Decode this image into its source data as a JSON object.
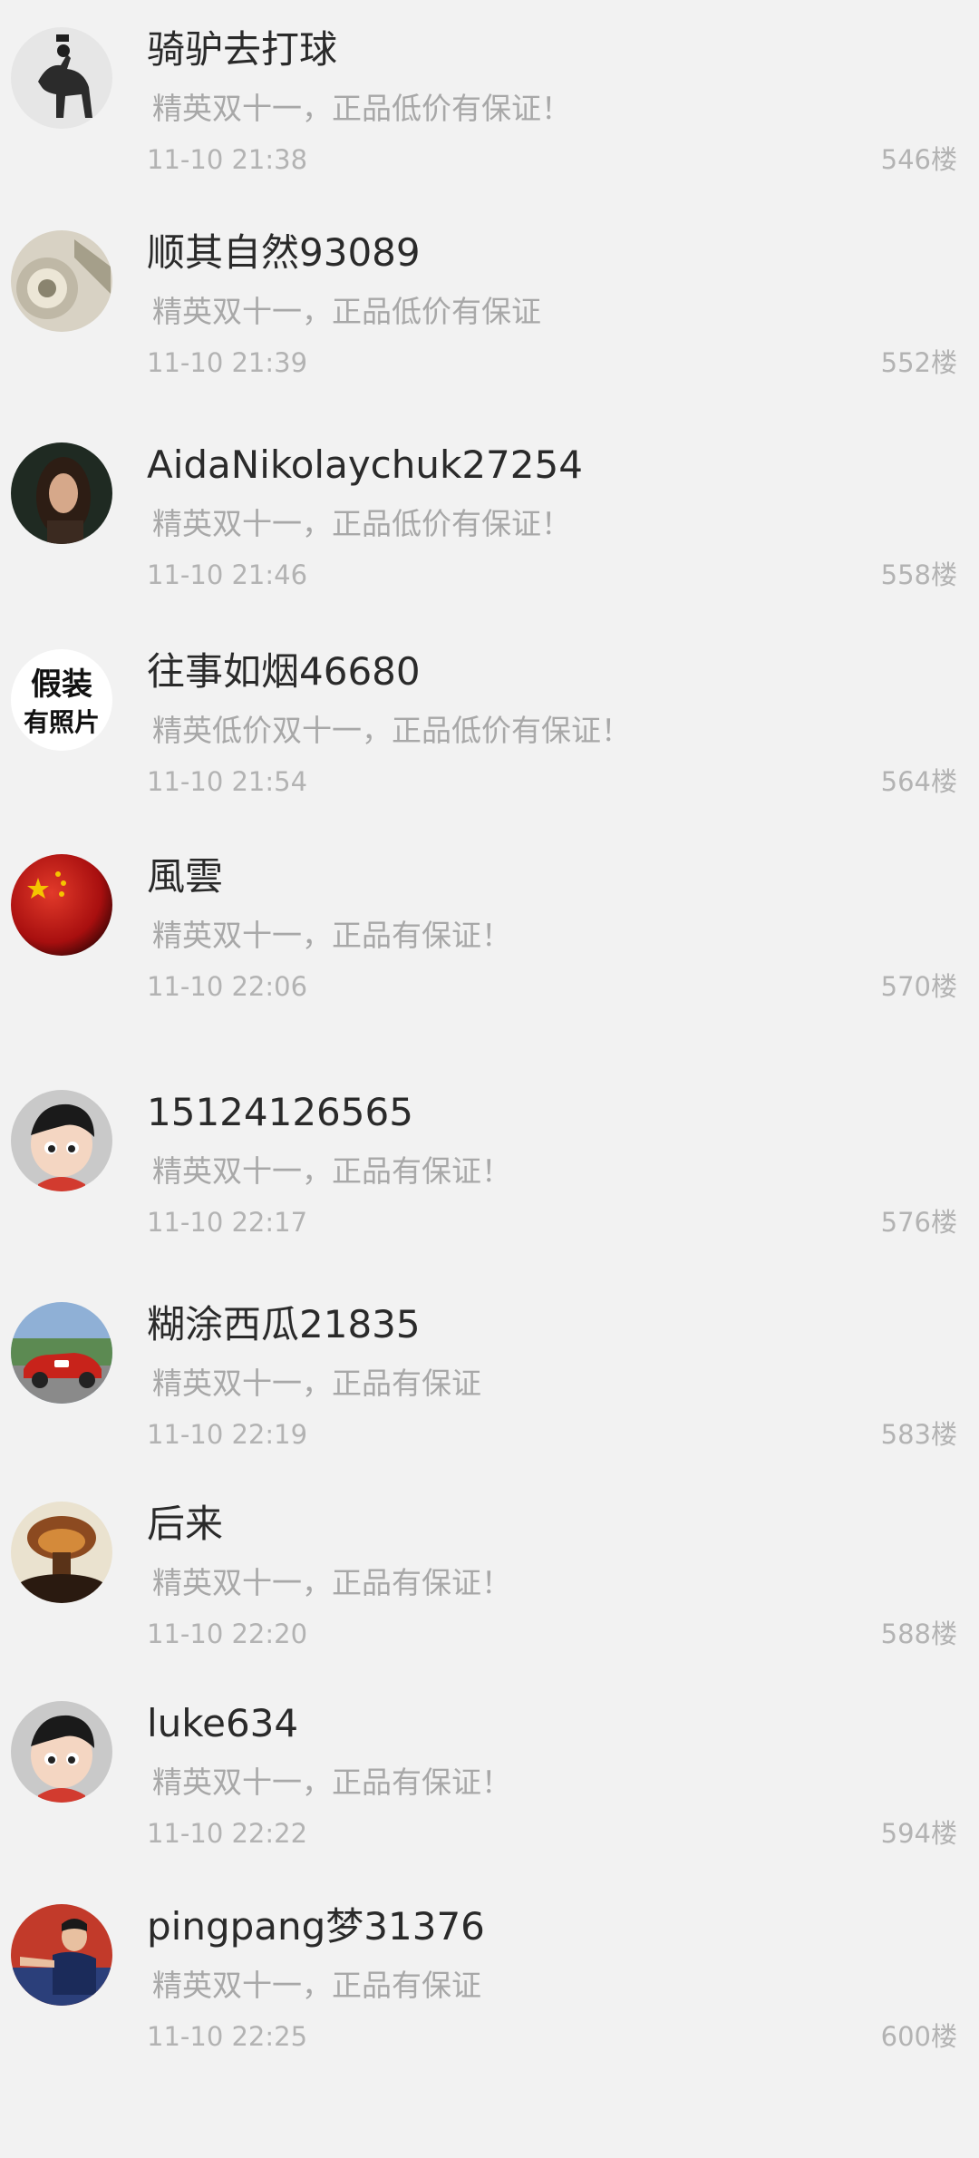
{
  "comments": [
    {
      "name": "骑驴去打球",
      "content": "精英双十一，正品低价有保证！",
      "time": "11-10 21:38",
      "floor": "546楼",
      "avatar_icon": "donkey-rider-avatar-icon"
    },
    {
      "name": "顺其自然93089",
      "content": "精英双十一，正品低价有保证",
      "time": "11-10 21:39",
      "floor": "552楼",
      "avatar_icon": "watch-avatar-icon"
    },
    {
      "name": "AidaNikolaychuk27254",
      "content": "精英双十一，正品低价有保证！",
      "time": "11-10 21:46",
      "floor": "558楼",
      "avatar_icon": "girl-portrait-avatar-icon"
    },
    {
      "name": "往事如烟46680",
      "content": "精英低价双十一，正品低价有保证！",
      "time": "11-10 21:54",
      "floor": "564楼",
      "avatar_icon": "text-stamp-avatar-icon",
      "avatar_text": "假装有照片"
    },
    {
      "name": "風雲",
      "content": "精英双十一，正品有保证！",
      "time": "11-10 22:06",
      "floor": "570楼",
      "avatar_icon": "red-flag-sphere-avatar-icon"
    },
    {
      "name": "15124126565",
      "content": "精英双十一，正品有保证！",
      "time": "11-10 22:17",
      "floor": "576楼",
      "avatar_icon": "cartoon-boy-avatar-icon"
    },
    {
      "name": "糊涂西瓜21835",
      "content": "精英双十一，正品有保证",
      "time": "11-10 22:19",
      "floor": "583楼",
      "avatar_icon": "red-car-avatar-icon"
    },
    {
      "name": "后来",
      "content": "精英双十一，正品有保证！",
      "time": "11-10 22:20",
      "floor": "588楼",
      "avatar_icon": "explosion-cloud-avatar-icon"
    },
    {
      "name": "luke634",
      "content": "精英双十一，正品有保证！",
      "time": "11-10 22:22",
      "floor": "594楼",
      "avatar_icon": "cartoon-boy-avatar-icon"
    },
    {
      "name": "pingpang梦31376",
      "content": "精英双十一，正品有保证",
      "time": "11-10 22:25",
      "floor": "600楼",
      "avatar_icon": "pingpong-player-avatar-icon"
    }
  ]
}
